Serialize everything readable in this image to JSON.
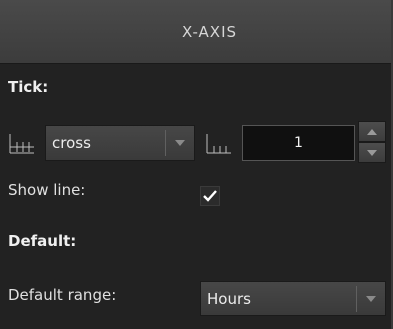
{
  "header": {
    "title": "X-AXIS"
  },
  "tick": {
    "section_title": "Tick:",
    "type_icon": "tick-cross-icon",
    "type_value": "cross",
    "count_icon": "tick-inside-icon",
    "count_value": "1",
    "show_line_label": "Show line:",
    "show_line_checked": true
  },
  "default": {
    "section_title": "Default:",
    "range_label": "Default range:",
    "range_value": "Hours"
  },
  "colors": {
    "background": "#222222",
    "header": "#424242",
    "field": "#101010",
    "text": "#e4e4e4"
  }
}
